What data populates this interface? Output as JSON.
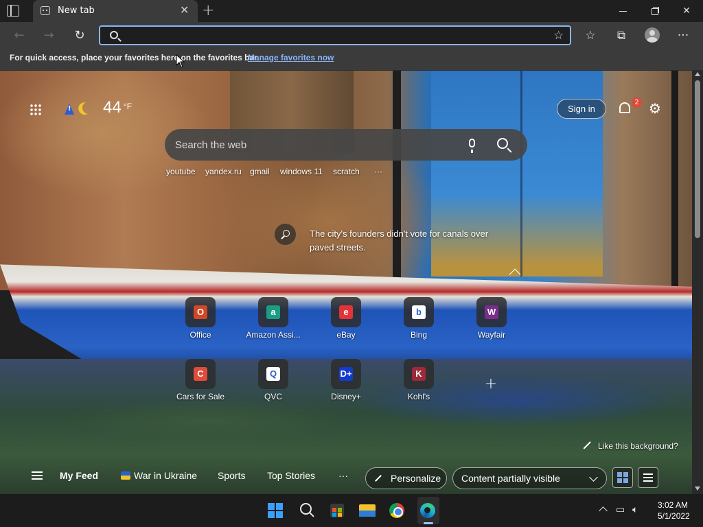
{
  "browser": {
    "tab": {
      "title": "New tab"
    },
    "address_bar": {
      "value": "",
      "placeholder": ""
    },
    "favorites_bar": {
      "message": "For quick access, place your favorites here on the favorites bar.",
      "link": "Manage favorites now"
    }
  },
  "page": {
    "weather": {
      "temperature": "44",
      "unit": "°F"
    },
    "header": {
      "sign_in": "Sign in",
      "notification_count": "2"
    },
    "search": {
      "placeholder": "Search the web"
    },
    "quick_links": [
      "youtube",
      "yandex.ru",
      "gmail",
      "windows 11",
      "scratch",
      "···"
    ],
    "image_fact": "The city's founders didn't vote for canals over paved streets.",
    "tiles": [
      {
        "label": "Office",
        "glyph": "O",
        "color": "#d24726"
      },
      {
        "label": "Amazon Assi...",
        "glyph": "a",
        "color": "#1b9c85"
      },
      {
        "label": "eBay",
        "glyph": "e",
        "color": "#e53238"
      },
      {
        "label": "Bing",
        "glyph": "b",
        "color": "#ffffff"
      },
      {
        "label": "Wayfair",
        "glyph": "W",
        "color": "#7b2d8e"
      },
      {
        "label": "Cars for Sale",
        "glyph": "C",
        "color": "#e04b3a"
      },
      {
        "label": "QVC",
        "glyph": "Q",
        "color": "#ffffff"
      },
      {
        "label": "Disney+",
        "glyph": "D+",
        "color": "#113ccf"
      },
      {
        "label": "Kohl's",
        "glyph": "K",
        "color": "#9b2a3b"
      }
    ],
    "like_background": "Like this background?",
    "feed": {
      "my_feed": "My Feed",
      "items": [
        "War in Ukraine",
        "Sports",
        "Top Stories"
      ],
      "more": "···",
      "personalize": "Personalize",
      "content_visibility": "Content partially visible"
    }
  },
  "taskbar": {
    "time": "3:02 AM",
    "date": "5/1/2022"
  },
  "colors": {
    "accent": "#8ab4f8",
    "notification_badge": "#d94a3b"
  }
}
